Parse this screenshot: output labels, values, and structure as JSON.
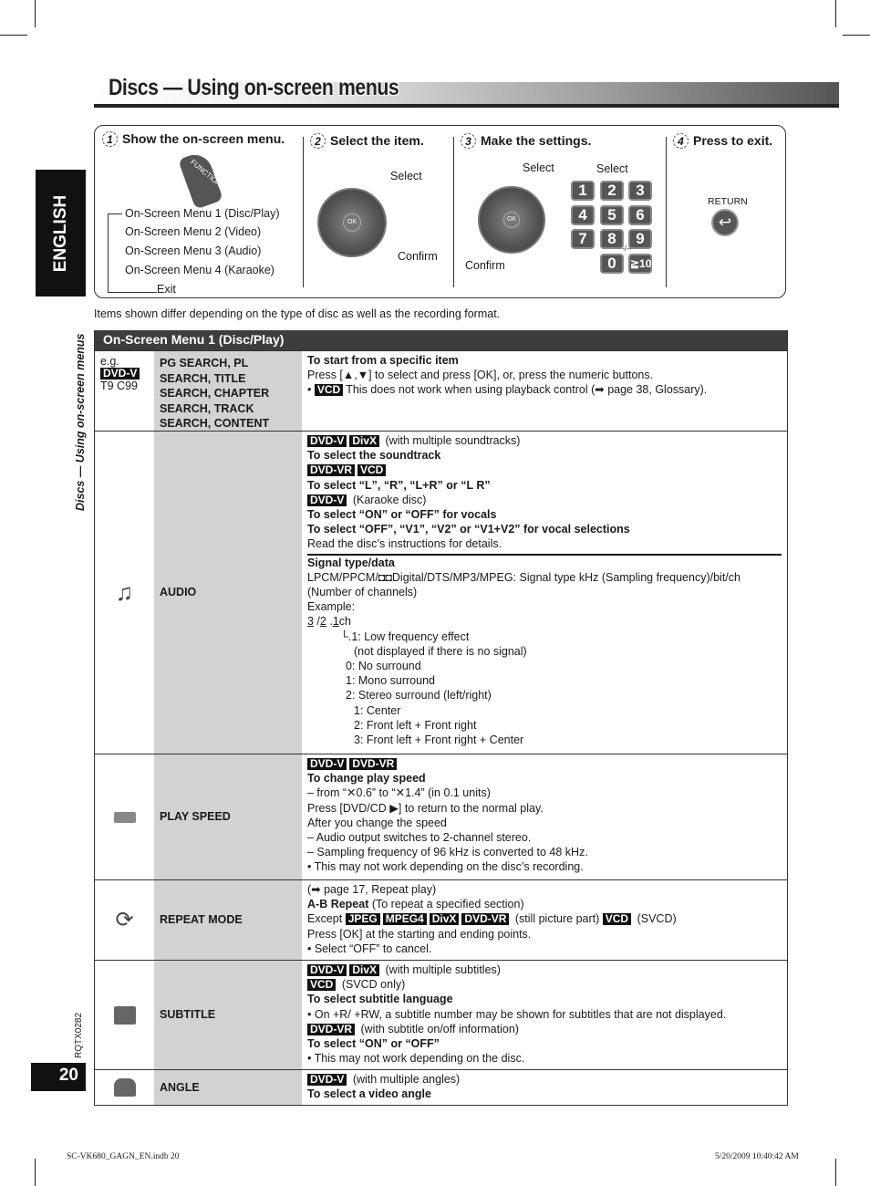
{
  "title": "Discs — Using on-screen menus",
  "sidebar": {
    "language": "ENGLISH",
    "section": "Discs — Using on-screen menus",
    "code": "RQTX0282",
    "page_number": "20"
  },
  "steps": [
    {
      "num": "1",
      "heading": "Show the on-screen menu.",
      "button": "FUNCTIONS",
      "menu": [
        "On-Screen Menu 1 (Disc/Play)",
        "On-Screen Menu 2 (Video)",
        "On-Screen Menu 3 (Audio)",
        "On-Screen Menu 4 (Karaoke)",
        "Exit"
      ]
    },
    {
      "num": "2",
      "heading": "Select the item.",
      "select": "Select",
      "confirm": "Confirm",
      "ok": "OK"
    },
    {
      "num": "3",
      "heading": "Make the settings.",
      "select": "Select",
      "select2": "Select",
      "confirm": "Confirm",
      "ok": "OK",
      "keys": [
        "1",
        "2",
        "3",
        "4",
        "5",
        "6",
        "7",
        "8",
        "9",
        "0",
        "≧10"
      ],
      "key_small": "-/--"
    },
    {
      "num": "4",
      "heading": "Press to exit.",
      "button": "RETURN"
    }
  ],
  "note": "Items shown differ depending on the type of disc as well as the recording format.",
  "table": {
    "header": "On-Screen Menu 1 (Disc/Play)",
    "rows": [
      {
        "icon": "",
        "eg": [
          "e.g.",
          "DVD-V",
          "T9 C99"
        ],
        "item": "PG SEARCH, PL SEARCH, TITLE SEARCH, CHAPTER SEARCH, TRACK SEARCH, CONTENT SEARCH",
        "lines": [
          [
            {
              "t": "b",
              "v": "To start from a specific item"
            }
          ],
          [
            {
              "t": "n",
              "v": "Press [▲,▼] to select and press [OK], or, press the numeric buttons."
            }
          ],
          [
            {
              "t": "n",
              "v": "•  "
            },
            {
              "t": "badge",
              "v": "VCD"
            },
            {
              "t": "n",
              "v": "This does not work when using playback control (➡ page 38, Glossary)."
            }
          ]
        ]
      },
      {
        "icon": "music-note-icon",
        "item": "AUDIO",
        "lines": [
          [
            {
              "t": "badge",
              "v": "DVD-V"
            },
            {
              "t": "badge",
              "v": "DivX"
            },
            {
              "t": "n",
              "v": " (with multiple soundtracks)"
            }
          ],
          [
            {
              "t": "b",
              "v": "To select the soundtrack"
            }
          ],
          [
            {
              "t": "badge",
              "v": "DVD-VR"
            },
            {
              "t": "badge",
              "v": "VCD"
            }
          ],
          [
            {
              "t": "b",
              "v": "To select “L”, “R”, “L+R” or “L R”"
            }
          ],
          [
            {
              "t": "badge",
              "v": "DVD-V"
            },
            {
              "t": "n",
              "v": " (Karaoke disc)"
            }
          ],
          [
            {
              "t": "b",
              "v": "To select “ON” or “OFF” for vocals"
            }
          ],
          [
            {
              "t": "b",
              "v": "To select “OFF”, “V1”, “V2” or “V1+V2” for vocal selections"
            }
          ],
          [
            {
              "t": "n",
              "v": "Read the disc’s instructions for details."
            }
          ],
          {
            "cls": "sep",
            "segs": [
              {
                "t": "b",
                "v": "Signal type/data"
              }
            ]
          },
          [
            {
              "t": "n",
              "v": "LPCM/PPCM/◘◘Digital/DTS/MP3/MPEG: Signal type kHz (Sampling frequency)/bit/ch"
            }
          ],
          [
            {
              "t": "n",
              "v": "(Number of channels)"
            }
          ],
          [
            {
              "t": "n",
              "v": "Example:"
            }
          ],
          [
            {
              "t": "u",
              "v": "3"
            },
            {
              "t": "n",
              "v": " /"
            },
            {
              "t": "u",
              "v": "2"
            },
            {
              "t": "n",
              "v": " ."
            },
            {
              "t": "u",
              "v": "1"
            },
            {
              "t": "n",
              "v": "ch"
            }
          ],
          {
            "cls": "l1",
            "segs": [
              {
                "t": "n",
                "v": "└.1: Low frequency effect"
              }
            ]
          },
          {
            "cls": "l3",
            "segs": [
              {
                "t": "n",
                "v": "(not displayed if there is no signal)"
              }
            ]
          },
          {
            "cls": "l2",
            "segs": [
              {
                "t": "n",
                "v": "0: No surround"
              }
            ]
          },
          {
            "cls": "l2",
            "segs": [
              {
                "t": "n",
                "v": "1: Mono surround"
              }
            ]
          },
          {
            "cls": "l2",
            "segs": [
              {
                "t": "n",
                "v": "2: Stereo surround (left/right)"
              }
            ]
          },
          {
            "cls": "l3",
            "segs": [
              {
                "t": "n",
                "v": "1: Center"
              }
            ]
          },
          {
            "cls": "l3",
            "segs": [
              {
                "t": "n",
                "v": "2: Front left + Front right"
              }
            ]
          },
          {
            "cls": "l3",
            "segs": [
              {
                "t": "n",
                "v": "3: Front left + Front right + Center"
              }
            ]
          }
        ]
      },
      {
        "icon": "play-speed-icon",
        "item": "PLAY SPEED",
        "lines": [
          [
            {
              "t": "badge",
              "v": "DVD-V"
            },
            {
              "t": "badge",
              "v": "DVD-VR"
            }
          ],
          [
            {
              "t": "b",
              "v": "To change play speed"
            }
          ],
          [
            {
              "t": "n",
              "v": "– from “✕0.6” to “✕1.4” (in 0.1 units)"
            }
          ],
          [
            {
              "t": "n",
              "v": "Press [DVD/CD ▶] to return to the normal play."
            }
          ],
          [
            {
              "t": "n",
              "v": "After you change the speed"
            }
          ],
          [
            {
              "t": "n",
              "v": "– Audio output switches to 2-channel stereo."
            }
          ],
          [
            {
              "t": "n",
              "v": "– Sampling frequency of 96 kHz is converted to 48 kHz."
            }
          ],
          [
            {
              "t": "n",
              "v": "•  This may not work depending on the disc’s recording."
            }
          ]
        ]
      },
      {
        "icon": "repeat-icon",
        "item": "REPEAT MODE",
        "lines": [
          [
            {
              "t": "n",
              "v": "(➡ page 17, Repeat play)"
            }
          ],
          [
            {
              "t": "b",
              "v": "A-B Repeat"
            },
            {
              "t": "n",
              "v": " (To repeat a specified section)"
            }
          ],
          [
            {
              "t": "n",
              "v": "Except "
            },
            {
              "t": "badge",
              "v": "JPEG"
            },
            {
              "t": "badge",
              "v": "MPEG4"
            },
            {
              "t": "badge",
              "v": "DivX"
            },
            {
              "t": "badge",
              "v": "DVD-VR"
            },
            {
              "t": "n",
              "v": " (still picture part) "
            },
            {
              "t": "badge",
              "v": "VCD"
            },
            {
              "t": "n",
              "v": " (SVCD)"
            }
          ],
          [
            {
              "t": "n",
              "v": "Press [OK] at the starting and ending points."
            }
          ],
          [
            {
              "t": "n",
              "v": "•  Select “OFF” to cancel."
            }
          ]
        ]
      },
      {
        "icon": "subtitle-icon",
        "item": "SUBTITLE",
        "lines": [
          [
            {
              "t": "badge",
              "v": "DVD-V"
            },
            {
              "t": "badge",
              "v": "DivX"
            },
            {
              "t": "n",
              "v": " (with multiple subtitles)"
            }
          ],
          [
            {
              "t": "badge",
              "v": "VCD"
            },
            {
              "t": "n",
              "v": " (SVCD only)"
            }
          ],
          [
            {
              "t": "b",
              "v": "To select subtitle language"
            }
          ],
          [
            {
              "t": "n",
              "v": "•  On +R/ +RW, a subtitle number may be shown for subtitles that are not displayed."
            }
          ],
          [
            {
              "t": "badge",
              "v": "DVD-VR"
            },
            {
              "t": "n",
              "v": " (with subtitle on/off information)"
            }
          ],
          [
            {
              "t": "b",
              "v": "To select “ON” or “OFF”"
            }
          ],
          [
            {
              "t": "n",
              "v": "•  This may not work depending on the disc."
            }
          ]
        ]
      },
      {
        "icon": "angle-icon",
        "item": "ANGLE",
        "lines": [
          [
            {
              "t": "badge",
              "v": "DVD-V"
            },
            {
              "t": "n",
              "v": " (with multiple angles)"
            }
          ],
          [
            {
              "t": "b",
              "v": "To select a video angle"
            }
          ]
        ]
      }
    ]
  },
  "footer": {
    "file": "SC-VK680_GAGN_EN.indb   20",
    "timestamp": "5/20/2009   10:40:42 AM"
  }
}
